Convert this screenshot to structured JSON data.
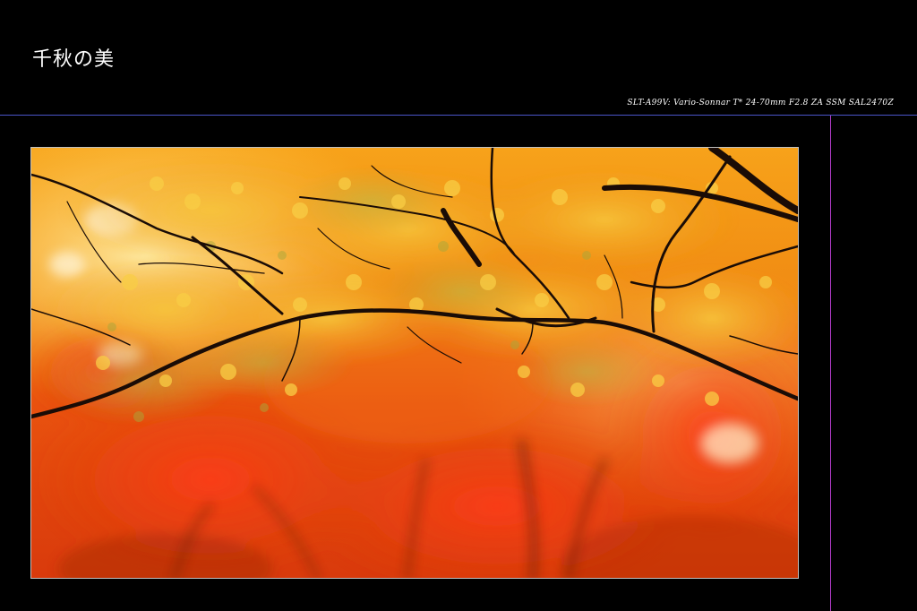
{
  "page": {
    "title": "千秋の美",
    "camera_caption": "SLT-A99V: Vario-Sonnar T* 24-70mm F2.8 ZA SSM SAL2470Z"
  },
  "colors": {
    "background": "#000000",
    "horizontal_rule": "#4a55c8",
    "vertical_rule": "#b03cc8",
    "photo_border": "#bfbfbf"
  },
  "photo": {
    "subject": "autumn maple branches"
  }
}
